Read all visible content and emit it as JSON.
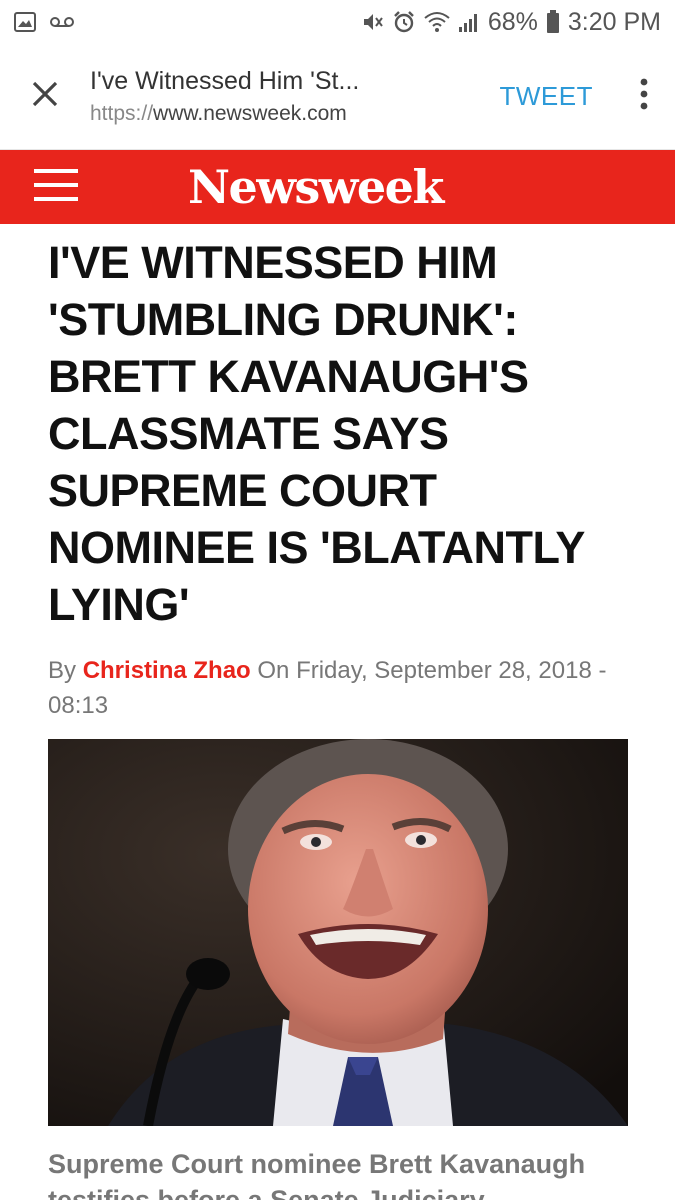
{
  "status_bar": {
    "battery_percent": "68%",
    "time": "3:20 PM",
    "icons": [
      "gallery-icon",
      "voicemail-icon",
      "mute-icon",
      "alarm-icon",
      "wifi-icon",
      "signal-icon",
      "battery-icon"
    ]
  },
  "toolbar": {
    "page_title": "I've Witnessed Him 'St...",
    "url_scheme": "https://",
    "url_host": "www.newsweek.com",
    "tweet_label": "TWEET",
    "icons": [
      "close-icon",
      "more-vert-icon"
    ]
  },
  "site_header": {
    "logo": "Newsweek",
    "menu_icon": "hamburger-menu-icon",
    "brand_color": "#e8251c"
  },
  "article": {
    "headline": "I'VE WITNESSED HIM 'STUMBLING DRUNK': BRETT KAVANAUGH'S CLASSMATE SAYS SUPREME COURT NOMINEE IS 'BLATANTLY LYING'",
    "byline_prefix": "By",
    "author": "Christina Zhao",
    "date_prefix": "On",
    "date": "Friday, September 28, 2018",
    "time": "- 08:13",
    "caption": "Supreme Court nominee Brett Kavanaugh testifies before a Senate Judiciary"
  }
}
